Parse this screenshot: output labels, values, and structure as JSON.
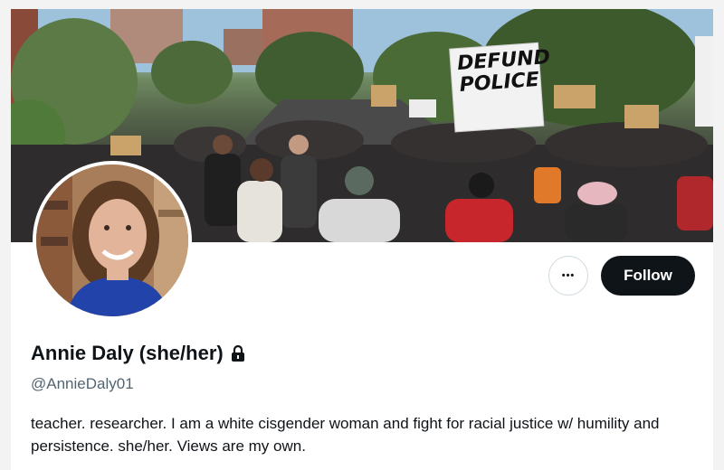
{
  "profile": {
    "display_name": "Annie Daly (she/her)",
    "handle": "@AnnieDaly01",
    "bio": "teacher. researcher. I am a white cisgender woman and fight for racial justice w/ humility and persistence. she/her. Views are my own.",
    "protected_icon": "lock-icon"
  },
  "banner": {
    "sign_text_line1": "DEFUND",
    "sign_text_line2": "POLICE"
  },
  "actions": {
    "more_label": "•••",
    "follow_label": "Follow"
  },
  "colors": {
    "primary_text": "#0f1419",
    "secondary_text": "#536471",
    "follow_bg": "#0f1419",
    "border": "#cfd9de"
  }
}
